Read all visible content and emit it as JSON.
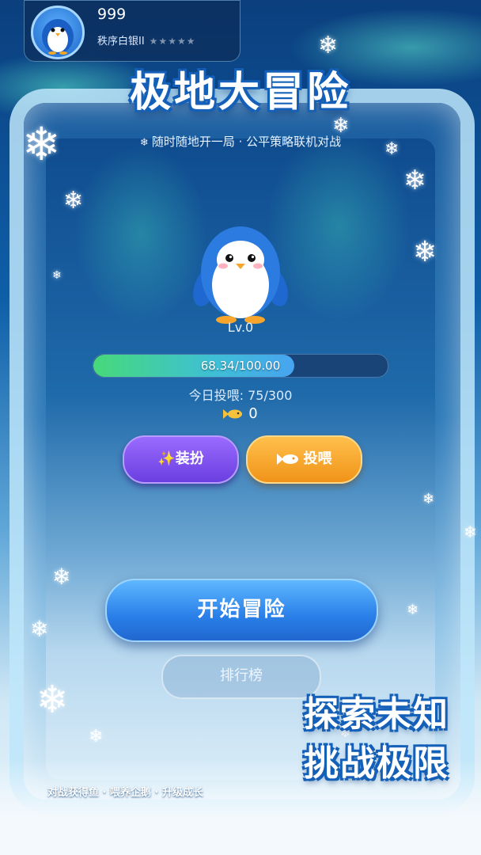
{
  "profile": {
    "coins": "999",
    "rank": "秩序白银II",
    "stars": "★★★★★"
  },
  "title": "极地大冒险",
  "subtitle": "随时随地开一局 · 公平策略联机对战",
  "pet": {
    "level": "Lv.0",
    "progress_text": "68.34/100.00",
    "progress_fraction": 0.6834,
    "feed_today": "今日投喂: 75/300",
    "fish_count": "0"
  },
  "buttons": {
    "dress": "✨装扮",
    "feed": "投喂",
    "start": "开始冒险",
    "rank": "排行榜"
  },
  "slogan": {
    "line1": "探索未知",
    "line2": "挑战极限"
  },
  "footer": "对战获得鱼 · 喂养企鹅 · 升级成长",
  "colors": {
    "accent_blue": "#2a7fe8",
    "dress_purple": "#7a4cf0",
    "feed_orange": "#f7a52b",
    "progress_green": "#47d97a"
  }
}
